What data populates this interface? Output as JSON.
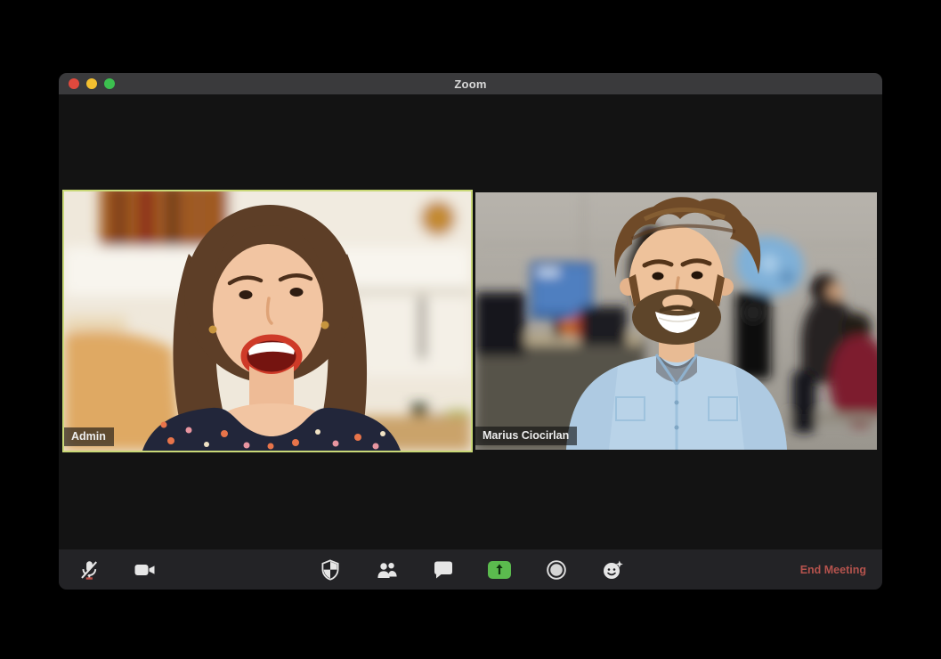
{
  "window": {
    "title": "Zoom",
    "traffic_lights": [
      {
        "name": "close",
        "color": "#e0493d"
      },
      {
        "name": "minimize",
        "color": "#f2bf30"
      },
      {
        "name": "maximize",
        "color": "#3cbf4f"
      }
    ]
  },
  "meeting": {
    "participants": [
      {
        "name": "Admin",
        "active_speaker": true
      },
      {
        "name": "Marius Ciocirlan",
        "active_speaker": false
      }
    ]
  },
  "toolbar": {
    "buttons": [
      {
        "icon": "microphone-muted-icon",
        "state": "muted"
      },
      {
        "icon": "video-camera-icon",
        "state": "on"
      },
      {
        "icon": "security-shield-icon"
      },
      {
        "icon": "participants-icon"
      },
      {
        "icon": "chat-bubble-icon"
      },
      {
        "icon": "share-screen-icon",
        "highlighted": true
      },
      {
        "icon": "record-icon"
      },
      {
        "icon": "reactions-smiley-icon"
      }
    ],
    "end_meeting_label": "End Meeting"
  },
  "colors": {
    "share_green": "#5bbb4e",
    "end_meeting_red": "#b5534d",
    "active_speaker_border": "#c9d877",
    "titlebar_bg": "#3a3a3c",
    "toolbar_bg": "#232326",
    "video_bg": "#131313",
    "page_bg": "#000000"
  }
}
